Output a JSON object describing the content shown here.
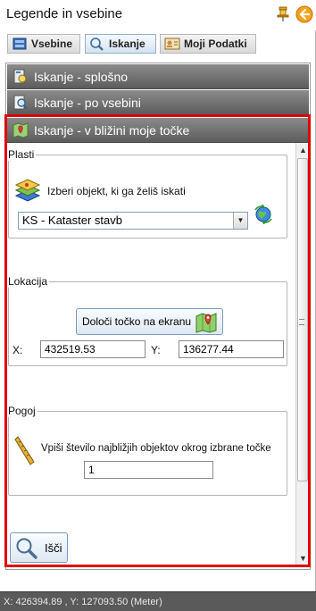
{
  "window": {
    "title": "Legende in vsebine"
  },
  "tabs": [
    {
      "label": "Vsebine",
      "icon": "layers-icon"
    },
    {
      "label": "Iskanje",
      "icon": "magnifier-icon"
    },
    {
      "label": "Moji Podatki",
      "icon": "id-card-icon"
    }
  ],
  "accordion": {
    "sections": [
      {
        "label": "Iskanje - splošno"
      },
      {
        "label": "Iskanje - po vsebini"
      },
      {
        "label": "Iskanje - v bližini moje točke"
      }
    ]
  },
  "plasti": {
    "legend": "Plasti",
    "prompt": "Izberi objekt, ki ga želiš iskati",
    "selected_layer": "KS - Kataster stavb"
  },
  "lokacija": {
    "legend": "Lokacija",
    "pick_button": "Določi točko na ekranu",
    "x_label": "X:",
    "x_value": "432519.53",
    "y_label": "Y:",
    "y_value": "136277.44"
  },
  "pogoj": {
    "legend": "Pogoj",
    "prompt": "Vpiši število najbližjih objektov okrog izbrane točke",
    "count_value": "1"
  },
  "search_button": "Išči",
  "status_bar": {
    "coordinates": "X: 426394.89 , Y: 127093.50 (Meter)"
  },
  "colors": {
    "highlight_frame": "#e00000",
    "accordion_header": "#6f6f6f",
    "status_bar": "#5a5a5a"
  }
}
